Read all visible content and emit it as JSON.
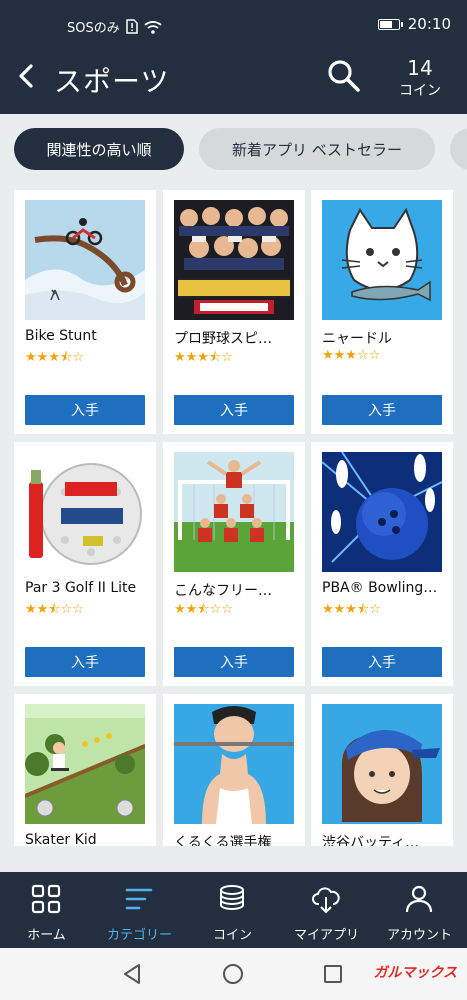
{
  "status": {
    "carrier": "SOSのみ",
    "time": "20:10"
  },
  "header": {
    "title": "スポーツ",
    "coins_value": "14",
    "coins_label": "コイン"
  },
  "filters": [
    {
      "label": "関連性の高い順",
      "active": true
    },
    {
      "label": "新着アプリ ベストセラー",
      "active": false
    }
  ],
  "apps": [
    {
      "name": "Bike Stunt",
      "stars": "★★★⯪☆",
      "rating": 3.5,
      "button": "入手",
      "icon": "bike-stunt-icon"
    },
    {
      "name": "プロ野球スピ…",
      "stars": "★★★⯪☆",
      "rating": 3.5,
      "button": "入手",
      "icon": "baseball-team-icon"
    },
    {
      "name": "ニャードル",
      "stars": "★★★☆☆",
      "rating": 3,
      "button": "入手",
      "icon": "cat-fish-icon"
    },
    {
      "name": "Par 3 Golf II Lite",
      "stars": "★★⯪☆☆",
      "rating": 2.5,
      "button": "入手",
      "icon": "golf-ball-icon"
    },
    {
      "name": "こんなフリー…",
      "stars": "★★⯪☆☆",
      "rating": 2.5,
      "button": "入手",
      "icon": "soccer-wall-icon"
    },
    {
      "name": "PBA® Bowling…",
      "stars": "★★★⯪☆",
      "rating": 3.5,
      "button": "入手",
      "icon": "bowling-icon"
    },
    {
      "name": "Skater Kid",
      "stars": "",
      "button": "",
      "icon": "skater-kid-icon"
    },
    {
      "name": "くるくる選手権",
      "stars": "",
      "button": "",
      "icon": "bar-athlete-icon"
    },
    {
      "name": "渋谷バッティ…",
      "stars": "",
      "button": "",
      "icon": "batting-girl-icon"
    }
  ],
  "nav": [
    {
      "label": "ホーム",
      "icon": "home-grid-icon",
      "active": false
    },
    {
      "label": "カテゴリー",
      "icon": "category-lines-icon",
      "active": true
    },
    {
      "label": "コイン",
      "icon": "coin-stack-icon",
      "active": false
    },
    {
      "label": "マイアプリ",
      "icon": "cloud-download-icon",
      "active": false
    },
    {
      "label": "アカウント",
      "icon": "person-icon",
      "active": false
    }
  ],
  "watermark": "ガルマックス",
  "colors": {
    "header": "#232f3e",
    "accent": "#4fb3f2",
    "button": "#1e6fbf",
    "star": "#f0a30a",
    "background": "#eaeded"
  }
}
